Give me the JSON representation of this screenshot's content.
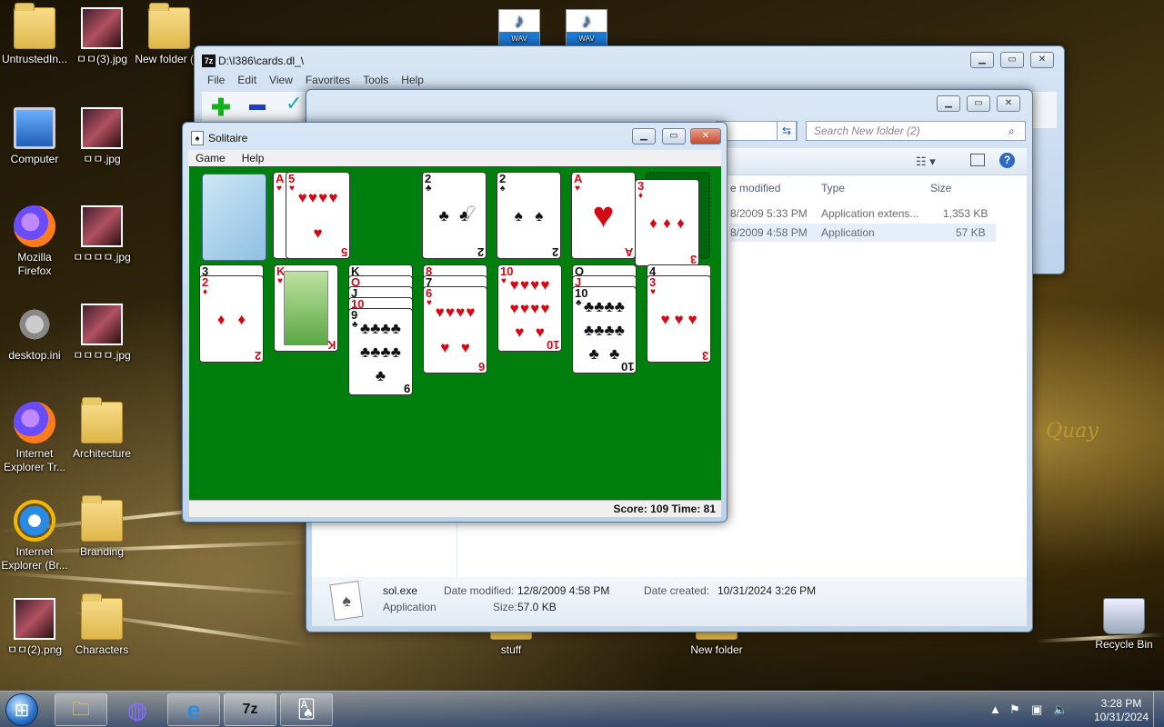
{
  "desktop": {
    "icons": [
      {
        "label": "UntrustedIn...",
        "icon": "user-folder-icon"
      },
      {
        "label": "ㅁㅁ(3).jpg",
        "icon": "image-icon"
      },
      {
        "label": "New folder (2)",
        "icon": "folder-icon"
      },
      {
        "label": "Computer",
        "icon": "computer-icon"
      },
      {
        "label": "ㅁㅁ.jpg",
        "icon": "image-icon"
      },
      {
        "label": "Mozilla Firefox",
        "icon": "firefox-icon"
      },
      {
        "label": "ㅁㅁㅁㅁ.jpg",
        "icon": "image-icon"
      },
      {
        "label": "desktop.ini",
        "icon": "settings-file-icon"
      },
      {
        "label": "ㅁㅁㅁㅁ.jpg",
        "icon": "image-icon"
      },
      {
        "label": "Internet Explorer Tr...",
        "icon": "tor-browser-icon"
      },
      {
        "label": "Architecture",
        "icon": "folder-icon"
      },
      {
        "label": "Internet Explorer (Br...",
        "icon": "ie-icon"
      },
      {
        "label": "Branding",
        "icon": "folder-icon"
      },
      {
        "label": "ㅁㅁ(2).png",
        "icon": "image-icon"
      },
      {
        "label": "Characters",
        "icon": "folder-icon"
      },
      {
        "label": "stuff",
        "icon": "folder-icon"
      },
      {
        "label": "New folder",
        "icon": "folder-icon"
      },
      {
        "label": "Recycle Bin",
        "icon": "recycle-bin-icon"
      }
    ],
    "wav_label": "WAV",
    "wallpaper_text": "Quay"
  },
  "sevenzip": {
    "title": "D:\\I386\\cards.dl_\\",
    "menu": [
      "File",
      "Edit",
      "View",
      "Favorites",
      "Tools",
      "Help"
    ]
  },
  "explorer": {
    "search_placeholder": "Search New folder (2)",
    "columns": {
      "modified": "e modified",
      "type": "Type",
      "size": "Size"
    },
    "rows": [
      {
        "date": "8/2009 5:33 PM",
        "type": "Application extens...",
        "size": "1,353 KB"
      },
      {
        "date": "8/2009 4:58 PM",
        "type": "Application",
        "size": "57 KB"
      }
    ],
    "details": {
      "name": "sol.exe",
      "kind": "Application",
      "modified_label": "Date modified:",
      "modified": "12/8/2009 4:58 PM",
      "size_label": "Size:",
      "size": "57.0 KB",
      "created_label": "Date created:",
      "created": "10/31/2024 3:26 PM"
    }
  },
  "solitaire": {
    "title": "Solitaire",
    "menu": [
      "Game",
      "Help"
    ],
    "status": "Score: 109 Time: 81",
    "waste": [
      {
        "rank": "A",
        "suit": "♥",
        "color": "red"
      },
      {
        "rank": "5",
        "suit": "♥",
        "color": "red"
      }
    ],
    "foundations": [
      {
        "rank": "2",
        "suit": "♣",
        "color": "black"
      },
      {
        "rank": "2",
        "suit": "♠",
        "color": "black"
      },
      {
        "rank": "A",
        "suit": "♥",
        "color": "red"
      }
    ],
    "dragging": {
      "rank": "3",
      "suit": "♦",
      "color": "red"
    },
    "tableau": [
      [
        {
          "rank": "3",
          "suit": "♠",
          "color": "black"
        },
        {
          "rank": "2",
          "suit": "♦",
          "color": "red"
        }
      ],
      [
        {
          "rank": "K",
          "suit": "♥",
          "color": "red",
          "face": true
        }
      ],
      [
        {
          "rank": "K",
          "suit": "",
          "color": "black"
        },
        {
          "rank": "Q",
          "suit": "",
          "color": "red"
        },
        {
          "rank": "J",
          "suit": "",
          "color": "black"
        },
        {
          "rank": "10",
          "suit": "",
          "color": "red"
        },
        {
          "rank": "9",
          "suit": "♣",
          "color": "black"
        }
      ],
      [
        {
          "rank": "8",
          "suit": "",
          "color": "red"
        },
        {
          "rank": "7",
          "suit": "",
          "color": "black"
        },
        {
          "rank": "6",
          "suit": "♥",
          "color": "red"
        }
      ],
      [
        {
          "rank": "10",
          "suit": "♥",
          "color": "red"
        }
      ],
      [
        {
          "rank": "Q",
          "suit": "",
          "color": "black"
        },
        {
          "rank": "J",
          "suit": "",
          "color": "red"
        },
        {
          "rank": "10",
          "suit": "♣",
          "color": "black"
        }
      ],
      [
        {
          "rank": "4",
          "suit": "",
          "color": "black"
        },
        {
          "rank": "3",
          "suit": "♥",
          "color": "red"
        }
      ]
    ]
  },
  "taskbar": {
    "buttons": [
      {
        "name": "explorer-taskbar-button",
        "glyph": "🗀"
      },
      {
        "name": "firefox-taskbar-button",
        "glyph": "◍"
      },
      {
        "name": "ie-taskbar-button",
        "glyph": "e"
      },
      {
        "name": "7zip-taskbar-button",
        "glyph": "7z"
      },
      {
        "name": "solitaire-taskbar-button",
        "glyph": "🂡"
      }
    ],
    "time": "3:28 PM",
    "date": "10/31/2024"
  }
}
